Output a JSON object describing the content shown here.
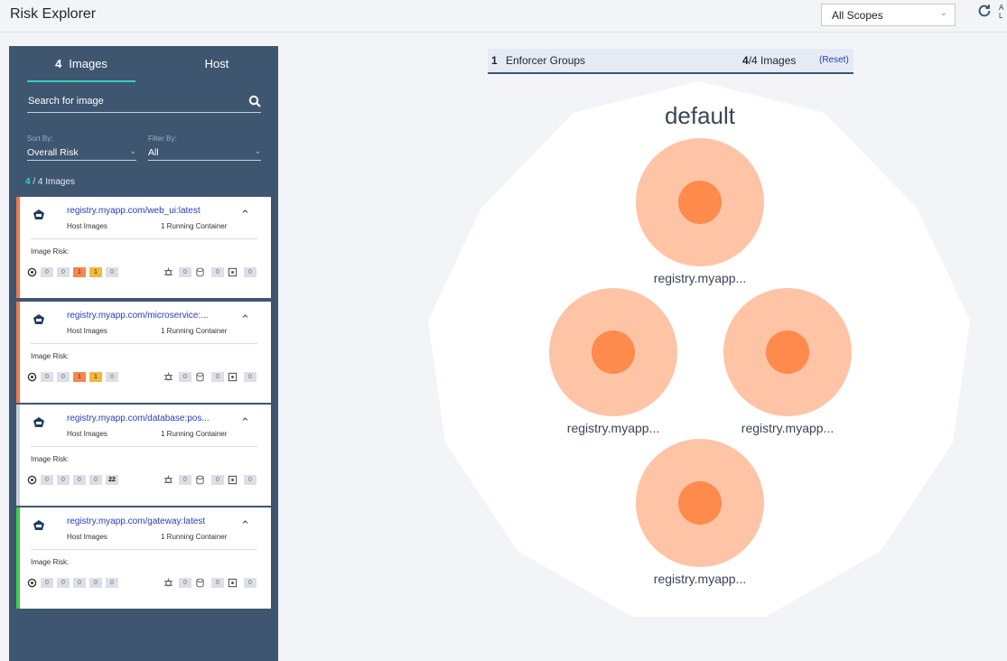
{
  "header": {
    "title": "Risk Explorer",
    "scope_value": "All Scopes",
    "cut_text": "A L"
  },
  "left_panel": {
    "tabs": [
      {
        "count": "4",
        "label": "Images"
      },
      {
        "label": "Host"
      }
    ],
    "search_placeholder": "Search for image",
    "sort_label": "Sort By:",
    "sort_value": "Overall Risk",
    "filter_label": "Filter By:",
    "filter_value": "All",
    "count_shown": "4",
    "count_rest": " / 4 Images",
    "cards": [
      {
        "name": "registry.myapp.com/web_ui:latest",
        "sub": "Host Images",
        "running": "1 Running Container",
        "risk_label": "Image Risk:",
        "accent": "#f0794a",
        "vulns": [
          "0",
          "0",
          "1",
          "1",
          "0"
        ],
        "others": [
          "0",
          "0",
          "0"
        ]
      },
      {
        "name": "registry.myapp.com/microservice:...",
        "sub": "Host Images",
        "running": "1 Running Container",
        "risk_label": "Image Risk:",
        "accent": "#f0794a",
        "vulns": [
          "0",
          "0",
          "1",
          "1",
          "0"
        ],
        "others": [
          "0",
          "0",
          "0"
        ]
      },
      {
        "name": "registry.myapp.com/database:pos...",
        "sub": "Host Images",
        "running": "1 Running Container",
        "risk_label": "Image Risk:",
        "accent": "#c9ced6",
        "vulns": [
          "0",
          "0",
          "0",
          "0",
          "22"
        ],
        "others": [
          "0",
          "0",
          "0"
        ]
      },
      {
        "name": "registry.myapp.com/gateway:latest",
        "sub": "Host Images",
        "running": "1 Running Container",
        "risk_label": "Image Risk:",
        "accent": "#3ccf4e",
        "vulns": [
          "0",
          "0",
          "0",
          "0",
          "0"
        ],
        "others": [
          "0",
          "0",
          "0"
        ]
      }
    ]
  },
  "group_bar": {
    "count": "1",
    "label": "Enforcer Groups",
    "images_shown": "4",
    "images_rest": "/4  Images",
    "reset": "(Reset)"
  },
  "graph": {
    "group_title": "default",
    "nodes": [
      {
        "label": "registry.myapp..."
      },
      {
        "label": "registry.myapp..."
      },
      {
        "label": "registry.myapp..."
      },
      {
        "label": "registry.myapp..."
      }
    ]
  },
  "colors": {
    "panel": "#3f5670",
    "accent_teal": "#2fd3c0",
    "risk_high": "#f5874f",
    "risk_medium": "#f3b93f",
    "node_outer": "#ffc4a6",
    "node_core": "#fe8a4c"
  }
}
